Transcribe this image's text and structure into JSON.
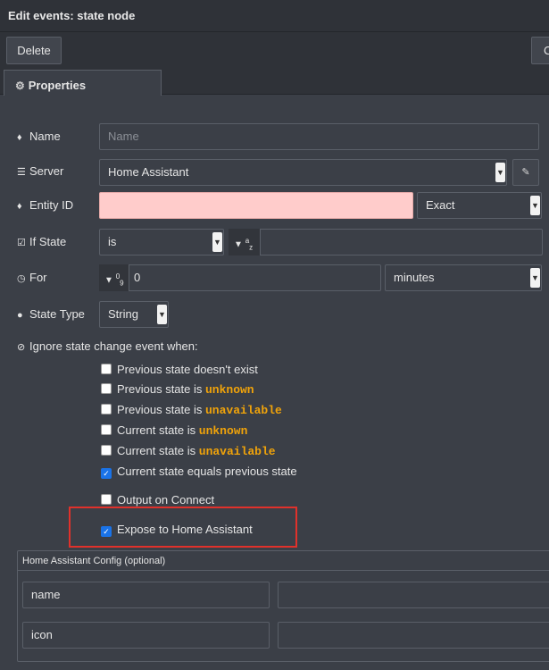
{
  "window": {
    "title": "Edit events: state node"
  },
  "toolbar": {
    "delete_label": "Delete",
    "cancel_label_partial": "C"
  },
  "tabs": [
    {
      "label": "Properties",
      "icon": "gear-icon"
    }
  ],
  "fields": {
    "name": {
      "label": "Name",
      "icon": "tag-icon",
      "placeholder": "Name",
      "value": ""
    },
    "server": {
      "label": "Server",
      "icon": "server-icon",
      "value": "Home Assistant"
    },
    "entity_id": {
      "label": "Entity ID",
      "icon": "tag-icon",
      "value": "",
      "match_mode": "Exact"
    },
    "if_state": {
      "label": "If State",
      "icon": "checkbox-icon",
      "operator": "is",
      "type_label": "a",
      "type_sub": "z",
      "value": ""
    },
    "for": {
      "label": "For",
      "icon": "clock-icon",
      "type_label": "0",
      "type_sub": "9",
      "value": "0",
      "unit": "minutes"
    },
    "state_type": {
      "label": "State Type",
      "icon": "droplet-icon",
      "value": "String"
    }
  },
  "ignore": {
    "heading": "Ignore state change event when:",
    "options": [
      {
        "prefix": "Previous state doesn't exist",
        "code": "",
        "checked": false
      },
      {
        "prefix": "Previous state is ",
        "code": "unknown",
        "checked": false
      },
      {
        "prefix": "Previous state is ",
        "code": "unavailable",
        "checked": false
      },
      {
        "prefix": "Current state is ",
        "code": "unknown",
        "checked": false
      },
      {
        "prefix": "Current state is ",
        "code": "unavailable",
        "checked": false
      },
      {
        "prefix": "Current state equals previous state",
        "code": "",
        "checked": true
      }
    ]
  },
  "output_on_connect": {
    "label": "Output on Connect",
    "checked": false
  },
  "expose": {
    "label": "Expose to Home Assistant",
    "checked": true
  },
  "ha_config": {
    "title": "Home Assistant Config (optional)",
    "rows": [
      {
        "key": "name",
        "value": ""
      },
      {
        "key": "icon",
        "value": ""
      }
    ]
  },
  "colors": {
    "highlight_box": "#e0312b",
    "code_text": "#f0a30a",
    "invalid_field": "#ffcccb",
    "checkbox_checked": "#1a73e8"
  }
}
